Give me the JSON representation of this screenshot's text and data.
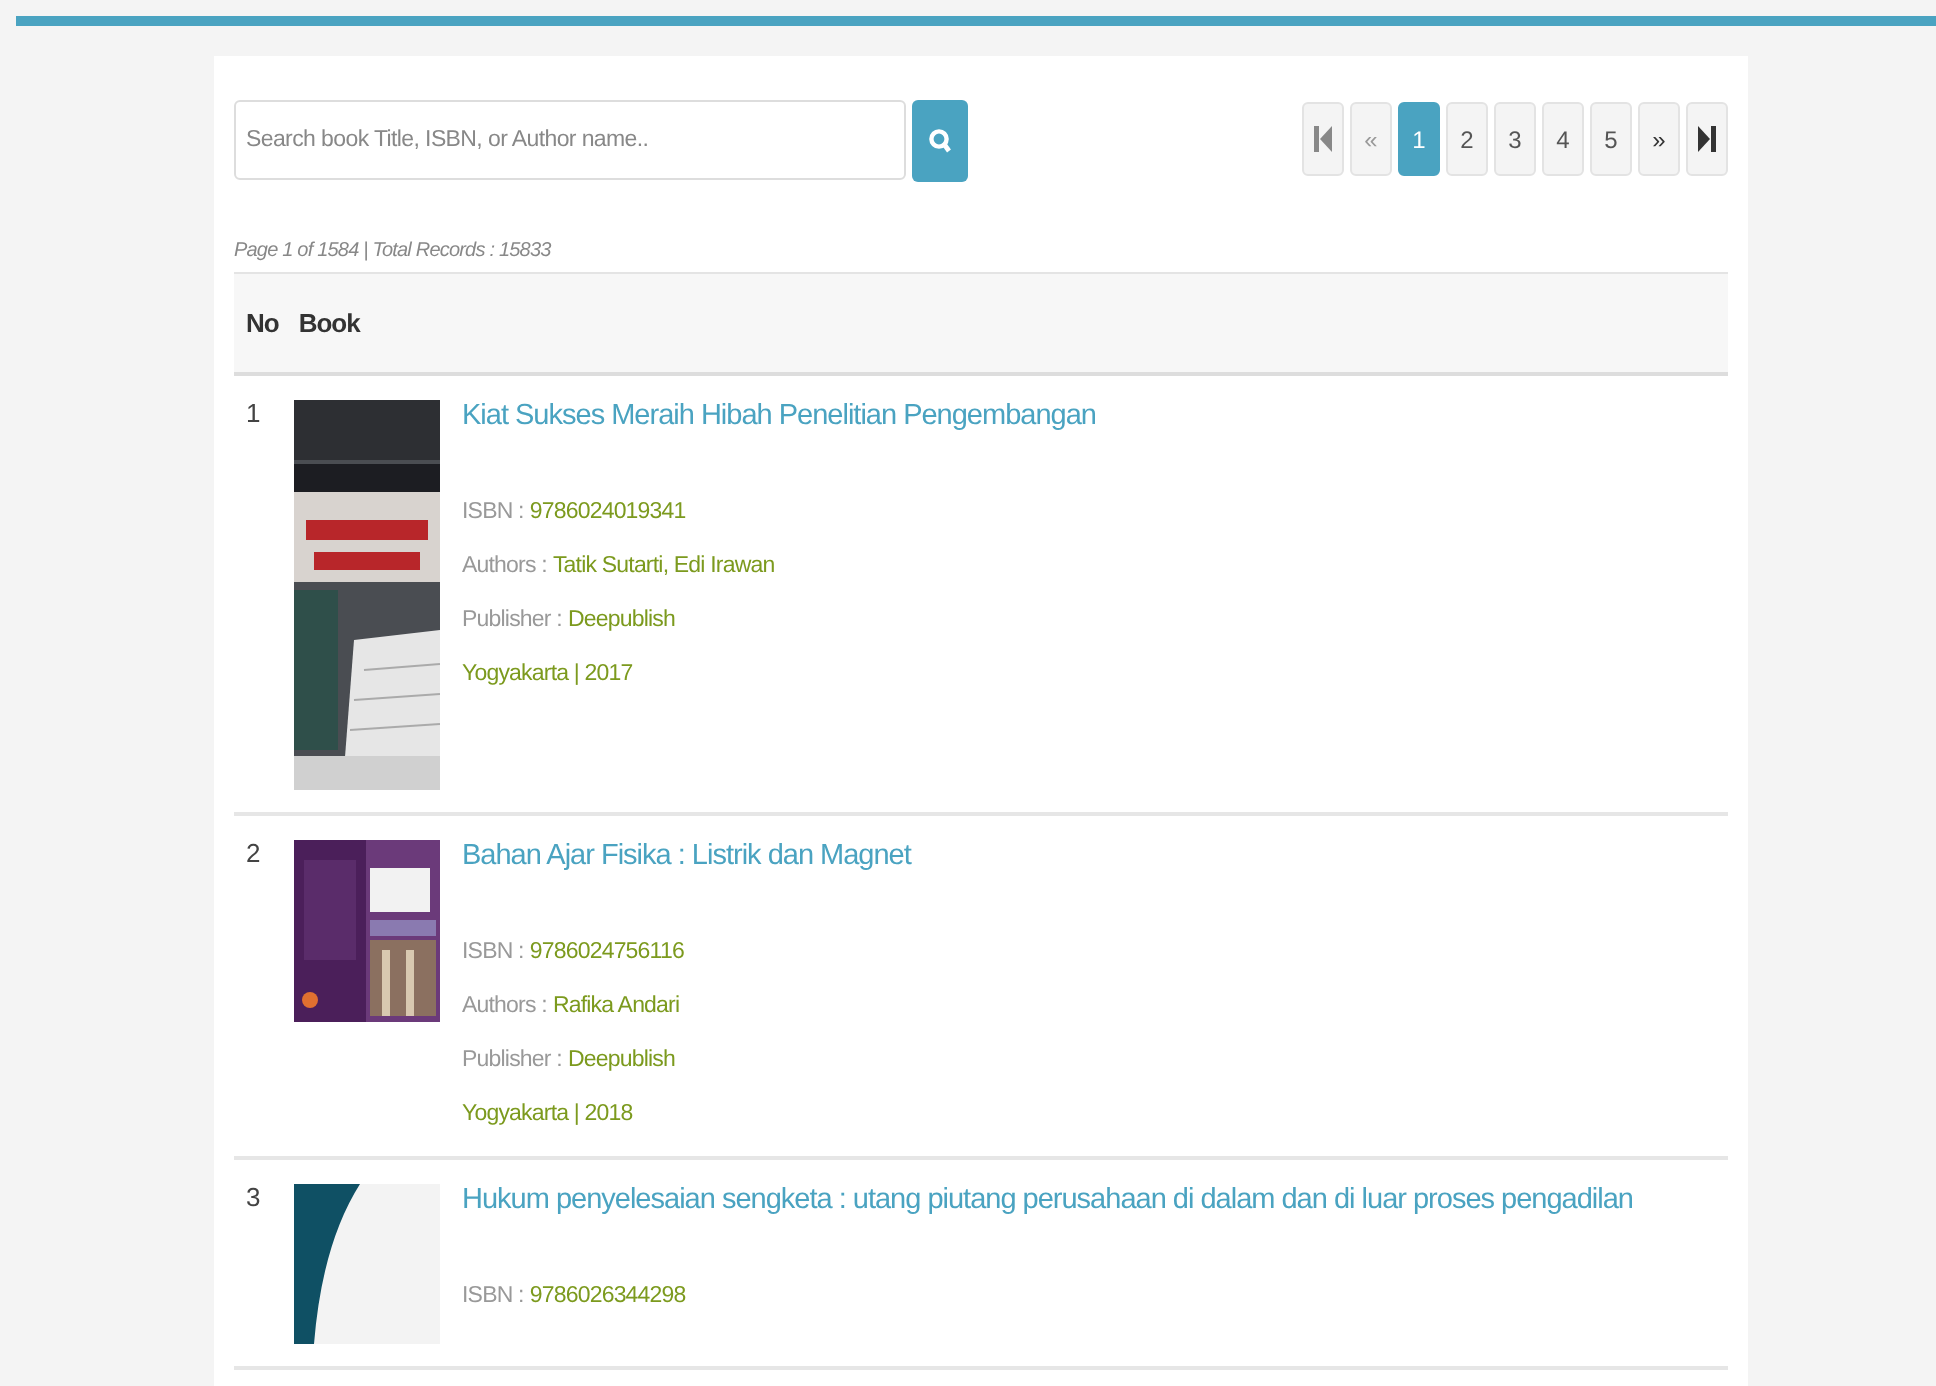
{
  "search": {
    "placeholder": "Search book Title, ISBN, or Author name.."
  },
  "pagination": [
    {
      "kind": "first",
      "selected": false
    },
    {
      "kind": "prev",
      "label": "«",
      "selected": false
    },
    {
      "kind": "page",
      "label": "1",
      "selected": true
    },
    {
      "kind": "page",
      "label": "2",
      "selected": false
    },
    {
      "kind": "page",
      "label": "3",
      "selected": false
    },
    {
      "kind": "page",
      "label": "4",
      "selected": false
    },
    {
      "kind": "page",
      "label": "5",
      "selected": false
    },
    {
      "kind": "next",
      "label": "»",
      "selected": false
    },
    {
      "kind": "last",
      "selected": false
    }
  ],
  "summary": "Page 1 of 1584 | Total Records : 15833",
  "table": {
    "columns": [
      "No",
      "Book"
    ],
    "rows": [
      {
        "no": "1",
        "cover": {
          "kind": "picture"
        },
        "title": "Kiat Sukses Meraih Hibah Penelitian Pengembangan",
        "fields": [
          {
            "label": "ISBN :",
            "value": "9786024019341"
          },
          {
            "label": "Authors :",
            "value": "Tatik Sutarti, Edi Irawan"
          },
          {
            "label": "Publisher :",
            "value": "Deepublish"
          }
        ],
        "place_year": "Yogyakarta | 2017"
      },
      {
        "no": "2",
        "cover": {
          "kind": "picture"
        },
        "title": "Bahan Ajar Fisika : Listrik dan Magnet",
        "fields": [
          {
            "label": "ISBN :",
            "value": "9786024756116"
          },
          {
            "label": "Authors :",
            "value": "Rafika Andari"
          },
          {
            "label": "Publisher :",
            "value": "Deepublish"
          }
        ],
        "place_year": "Yogyakarta | 2018"
      },
      {
        "no": "3",
        "cover": {
          "kind": "picture"
        },
        "title": "Hukum penyelesaian sengketa : utang piutang perusahaan di dalam dan di luar proses pengadilan",
        "fields": [
          {
            "label": "ISBN :",
            "value": "9786026344298"
          }
        ]
      }
    ]
  }
}
